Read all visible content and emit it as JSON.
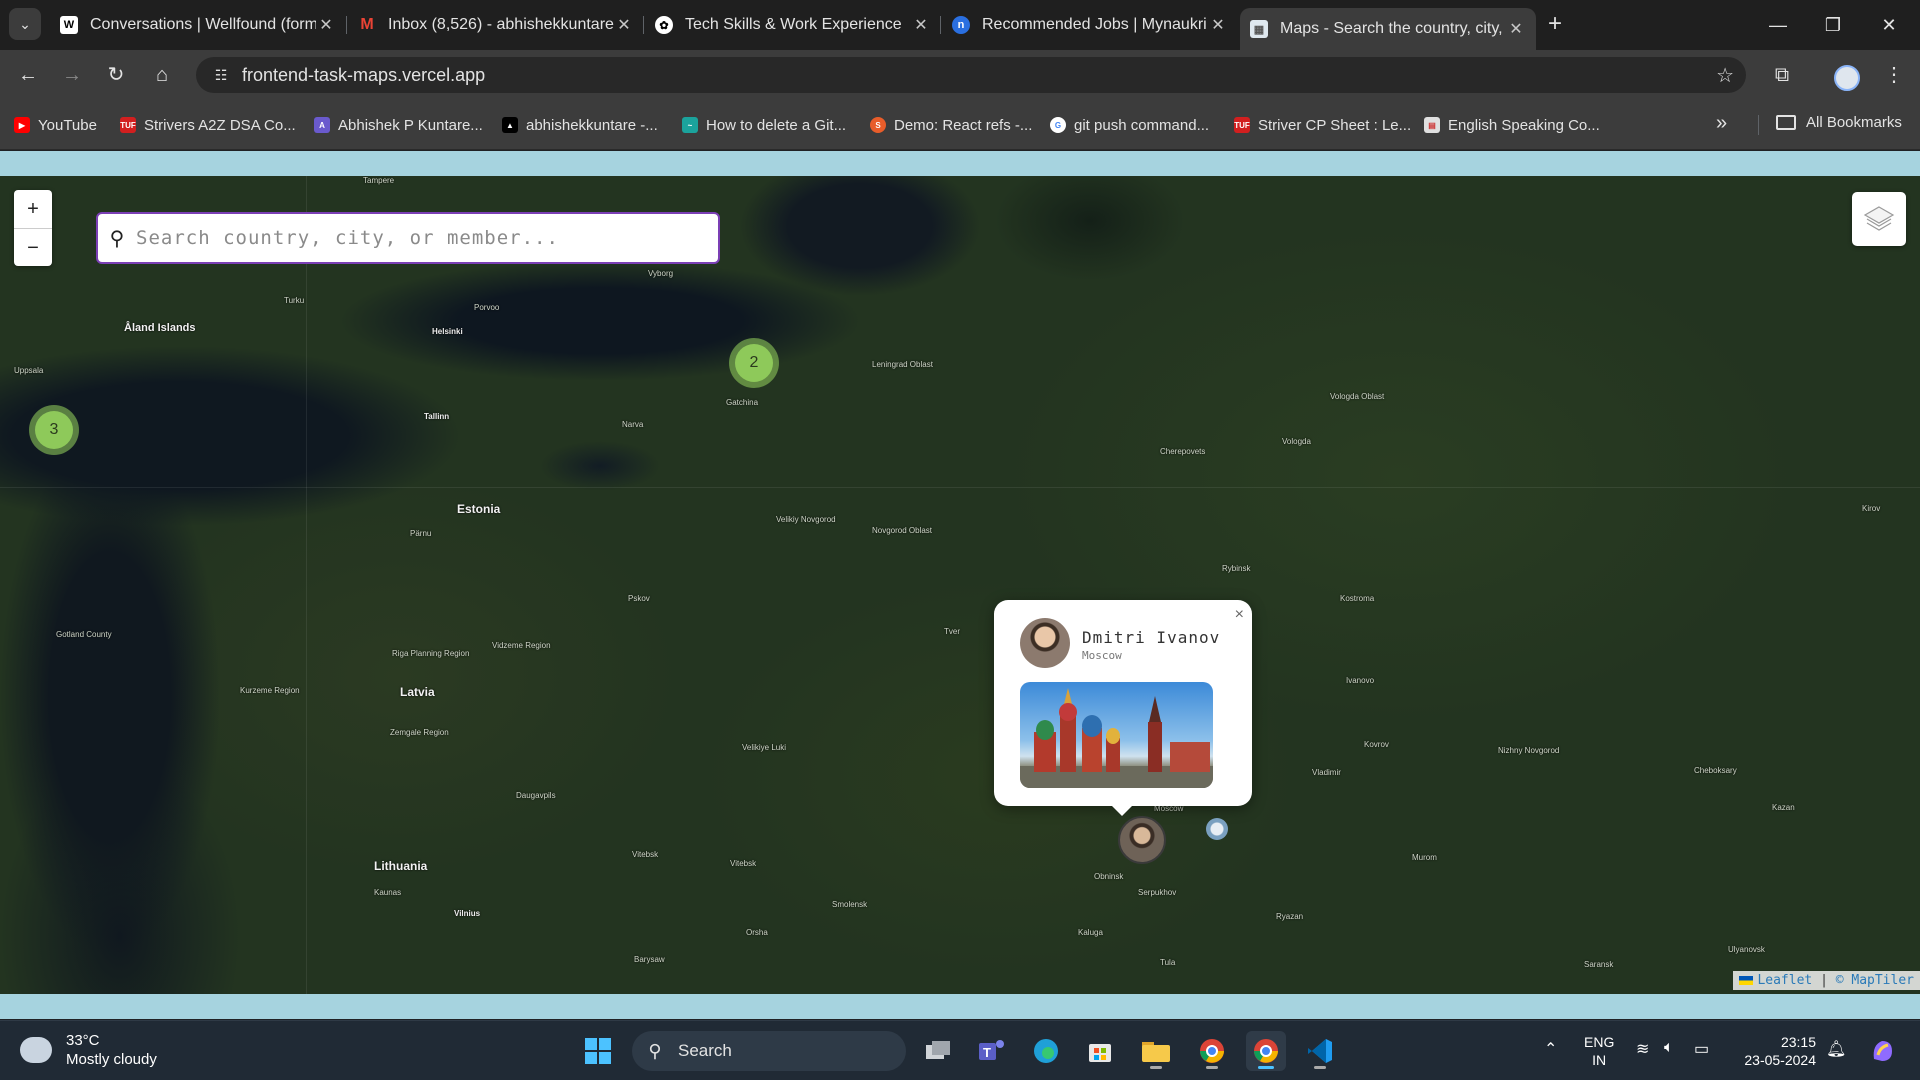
{
  "browser": {
    "tabs": [
      {
        "title": "Conversations | Wellfound (form",
        "favicon": "wellfound-icon",
        "active": false
      },
      {
        "title": "Inbox (8,526) - abhishekkuntare",
        "favicon": "gmail-icon",
        "active": false
      },
      {
        "title": "Tech Skills & Work Experience",
        "favicon": "chatgpt-icon",
        "active": false
      },
      {
        "title": "Recommended Jobs | Mynaukri",
        "favicon": "naukri-icon",
        "active": false
      },
      {
        "title": "Maps - Search the country, city,",
        "favicon": "maps-icon",
        "active": true
      }
    ],
    "address": {
      "url": "frontend-task-maps.vercel.app"
    },
    "bookmarks": [
      {
        "label": "YouTube",
        "icon": "youtube-icon",
        "color": "#ff0000"
      },
      {
        "label": "Strivers A2Z DSA Co...",
        "icon": "tuf-icon",
        "color": "#d21f1f"
      },
      {
        "label": "Abhishek P Kuntare...",
        "icon": "profile-icon",
        "color": "#6a5acd"
      },
      {
        "label": "abhishekkuntare -...",
        "icon": "vercel-icon",
        "color": "#000000"
      },
      {
        "label": "How to delete a Git...",
        "icon": "link-icon",
        "color": "#1ba39c"
      },
      {
        "label": "Demo: React refs -...",
        "icon": "codesandbox-icon",
        "color": "#e85d2a"
      },
      {
        "label": "git push command...",
        "icon": "google-icon",
        "color": "#ffffff"
      },
      {
        "label": "Striver CP Sheet : Le...",
        "icon": "tuf-icon",
        "color": "#d21f1f"
      },
      {
        "label": "English Speaking Co...",
        "icon": "course-icon",
        "color": "#e0e0e0"
      }
    ],
    "all_bookmarks": "All Bookmarks"
  },
  "map": {
    "search_placeholder": "Search country, city, or member...",
    "zoom_in": "+",
    "zoom_out": "−",
    "clusters": [
      {
        "count": "2",
        "region": "near St. Petersburg"
      },
      {
        "count": "3",
        "region": "near Stockholm"
      }
    ],
    "places": {
      "aland": "Åland Islands",
      "helsinki": "Helsinki",
      "tallinn": "Tallinn",
      "estonia": "Estonia",
      "latvia": "Latvia",
      "lithuania": "Lithuania",
      "vyborg": "Vyborg",
      "gatchina": "Gatchina",
      "narva": "Narva",
      "pskov": "Pskov",
      "riga_region": "Riga Planning Region",
      "vidzeme": "Vidzeme Region",
      "kurzeme": "Kurzeme Region",
      "zemgale": "Zemgale Region",
      "velikiy_novgorod": "Velikiy Novgorod",
      "novgorod_oblast": "Novgorod Oblast",
      "leningrad_oblast": "Leningrad Oblast",
      "cherepovets": "Cherepovets",
      "vologda": "Vologda",
      "vologda_oblast": "Vologda Oblast",
      "rybinsk": "Rybinsk",
      "kostroma": "Kostroma",
      "ivanovo": "Ivanovo",
      "kovrov": "Kovrov",
      "nizhny": "Nizhny Novgorod",
      "vladimir": "Vladimir",
      "velikiye_luki": "Velikiye Luki",
      "smolensk": "Smolensk",
      "obninsk": "Obninsk",
      "serpukhov": "Serpukhov",
      "kaluga": "Kaluga",
      "tula": "Tula",
      "ryazan": "Ryazan",
      "murom": "Murom",
      "moscow": "Moscow",
      "vilnius": "Vilnius",
      "kaunas": "Kaunas",
      "daugavpils": "Daugavpils",
      "orsha": "Orsha",
      "vitebsk": "Vitebsk",
      "barysaw": "Barysaw",
      "tampere": "Tampere",
      "turku": "Turku",
      "porvoo": "Porvoo",
      "parnu": "Pärnu",
      "gotland": "Gotland County",
      "uppsala": "Uppsala",
      "cheboksary": "Cheboksary",
      "kazan": "Kazan",
      "saransk": "Saransk",
      "ulyanovsk": "Ulyanovsk",
      "tver": "Tver",
      "kirov": "Kirov"
    },
    "popup": {
      "name": "Dmitri Ivanov",
      "city": "Moscow",
      "close": "×"
    },
    "attribution": {
      "leaflet": "Leaflet",
      "sep": "|",
      "maptiler": "© MapTiler"
    }
  },
  "taskbar": {
    "weather_temp": "33°C",
    "weather_cond": "Mostly cloudy",
    "search_label": "Search",
    "lang_1": "ENG",
    "lang_2": "IN",
    "time": "23:15",
    "date": "23-05-2024"
  }
}
